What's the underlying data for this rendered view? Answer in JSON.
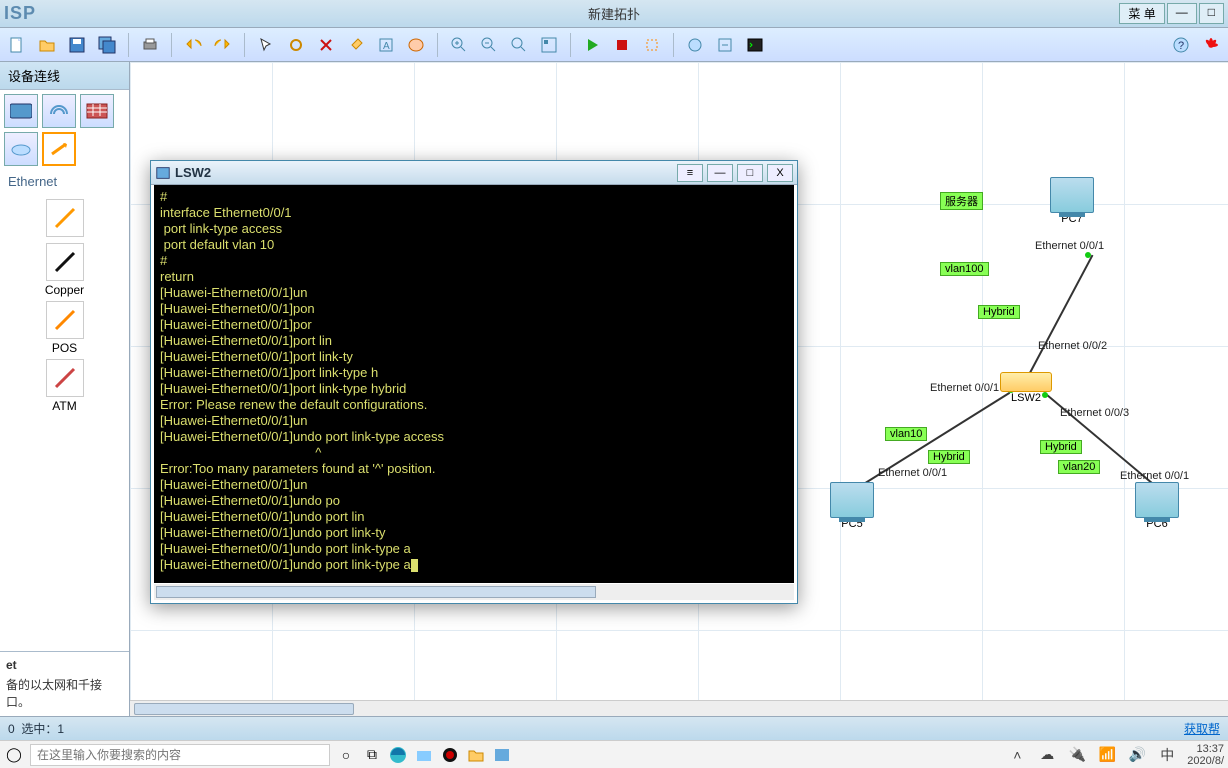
{
  "app": {
    "brand": "ISP",
    "title": "新建拓扑",
    "menu_btn": "菜 单"
  },
  "sidebar": {
    "header": "设备连线",
    "eth_label": "Ethernet",
    "connectors": [
      {
        "name": "Copper"
      },
      {
        "name": "POS"
      },
      {
        "name": "ATM"
      }
    ],
    "desc_title": "et",
    "desc_body": "备的以太网和千接口。"
  },
  "terminal": {
    "title": "LSW2",
    "lines": [
      "#",
      "interface Ethernet0/0/1",
      " port link-type access",
      " port default vlan 10",
      "#",
      "return",
      "[Huawei-Ethernet0/0/1]un",
      "[Huawei-Ethernet0/0/1]pon",
      "[Huawei-Ethernet0/0/1]por",
      "[Huawei-Ethernet0/0/1]port lin",
      "[Huawei-Ethernet0/0/1]port link-ty",
      "[Huawei-Ethernet0/0/1]port link-type h",
      "[Huawei-Ethernet0/0/1]port link-type hybrid",
      "Error: Please renew the default configurations.",
      "[Huawei-Ethernet0/0/1]un",
      "[Huawei-Ethernet0/0/1]undo port link-type access",
      "                                           ^",
      "Error:Too many parameters found at '^' position.",
      "[Huawei-Ethernet0/0/1]un",
      "[Huawei-Ethernet0/0/1]undo po",
      "[Huawei-Ethernet0/0/1]undo port lin",
      "[Huawei-Ethernet0/0/1]undo port link-ty",
      "[Huawei-Ethernet0/0/1]undo port link-type a",
      "[Huawei-Ethernet0/0/1]undo port link-type a"
    ]
  },
  "topology": {
    "nodes": {
      "pc5": {
        "label": "PC5",
        "port": "Ethernet 0/0/1"
      },
      "pc6": {
        "label": "PC6",
        "port": "Ethernet 0/0/1"
      },
      "pc7": {
        "label": "PC7",
        "port": "Ethernet 0/0/1"
      },
      "lsw2": {
        "label": "LSW2",
        "p1": "Ethernet 0/0/1",
        "p2": "Ethernet 0/0/2",
        "p3": "Ethernet 0/0/3"
      }
    },
    "tags": {
      "server": "服务器",
      "vlan100": "vlan100",
      "vlan10": "vlan10",
      "vlan20": "vlan20",
      "hybrid": "Hybrid"
    }
  },
  "status": {
    "left_zero": "0",
    "selected": "选中：1",
    "help": "获取帮"
  },
  "taskbar": {
    "search_placeholder": "在这里输入你要搜索的内容",
    "ime": "中",
    "time": "13:37",
    "date": "2020/8/"
  }
}
